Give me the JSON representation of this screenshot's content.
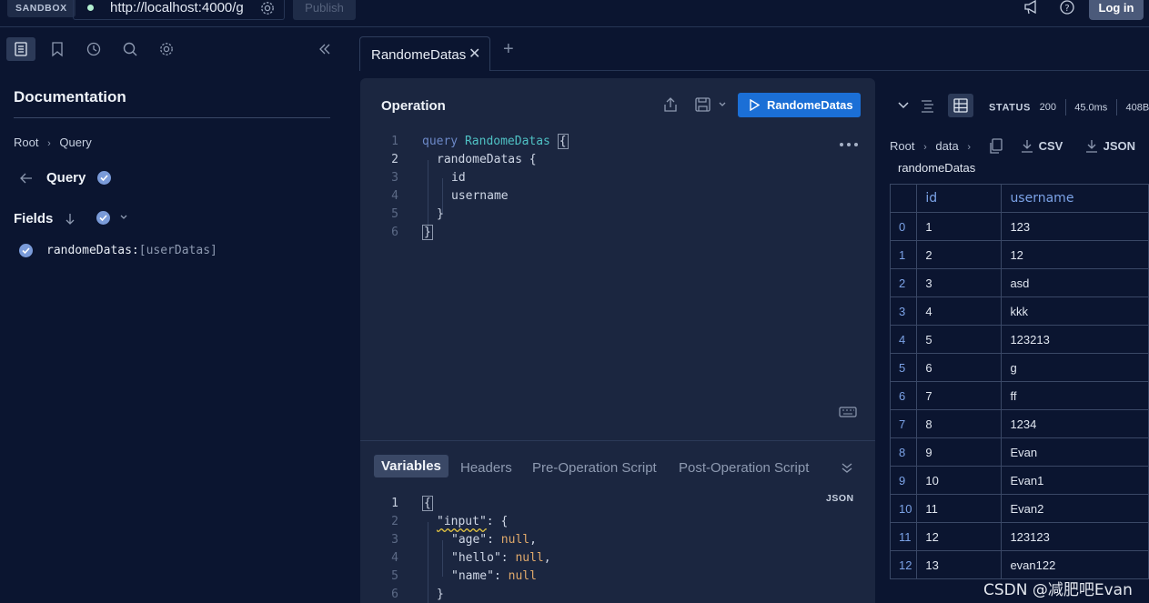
{
  "topbar": {
    "sandbox_label": "SANDBOX",
    "url": "http://localhost:4000/g",
    "publish_label": "Publish",
    "login_label": "Log in"
  },
  "sidebar": {
    "title": "Documentation",
    "breadcrumb": [
      "Root",
      "Query"
    ],
    "type_name": "Query",
    "fields_label": "Fields",
    "fields": [
      {
        "name": "randomeDatas:",
        "type": "[userDatas]"
      }
    ]
  },
  "tabs": [
    {
      "label": "RandomeDatas",
      "active": true
    }
  ],
  "operation": {
    "title": "Operation",
    "run_label": "RandomeDatas",
    "active_line": 2,
    "lines": [
      {
        "n": "1"
      },
      {
        "n": "2"
      },
      {
        "n": "3"
      },
      {
        "n": "4"
      },
      {
        "n": "5"
      },
      {
        "n": "6"
      }
    ],
    "tokens": {
      "keyword": "query",
      "op_name": "RandomeDatas",
      "open": "{",
      "field_root": "randomeDatas {",
      "f1": "id",
      "f2": "username",
      "close_inner": "}",
      "close_outer": "}"
    }
  },
  "variables": {
    "tabs": [
      "Variables",
      "Headers",
      "Pre-Operation Script",
      "Post-Operation Script"
    ],
    "format_label": "JSON",
    "lines": [
      "1",
      "2",
      "3",
      "4",
      "5",
      "6"
    ],
    "tokens": {
      "open": "{",
      "input_key": "\"input\"",
      "input_rest": ": {",
      "age_key": "\"age\"",
      "hello_key": "\"hello\"",
      "name_key": "\"name\"",
      "null": "null",
      "close": "}"
    }
  },
  "response": {
    "status_label": "STATUS",
    "status_code": "200",
    "time": "45.0ms",
    "size": "408B",
    "breadcrumb": [
      "Root",
      "data"
    ],
    "sub_path": "randomeDatas",
    "copy_label": "",
    "csv_label": "CSV",
    "json_label": "JSON",
    "columns": [
      "id",
      "username"
    ],
    "rows": [
      {
        "index": "0",
        "id": "1",
        "username": "123"
      },
      {
        "index": "1",
        "id": "2",
        "username": "12"
      },
      {
        "index": "2",
        "id": "3",
        "username": "asd"
      },
      {
        "index": "3",
        "id": "4",
        "username": "kkk"
      },
      {
        "index": "4",
        "id": "5",
        "username": "123213"
      },
      {
        "index": "5",
        "id": "6",
        "username": "g"
      },
      {
        "index": "6",
        "id": "7",
        "username": "ff"
      },
      {
        "index": "7",
        "id": "8",
        "username": "1234"
      },
      {
        "index": "8",
        "id": "9",
        "username": "Evan"
      },
      {
        "index": "9",
        "id": "10",
        "username": "Evan1"
      },
      {
        "index": "10",
        "id": "11",
        "username": "Evan2"
      },
      {
        "index": "11",
        "id": "12",
        "username": "123123"
      },
      {
        "index": "12",
        "id": "13",
        "username": "evan122"
      }
    ]
  },
  "watermark": "CSDN @减肥吧Evan"
}
